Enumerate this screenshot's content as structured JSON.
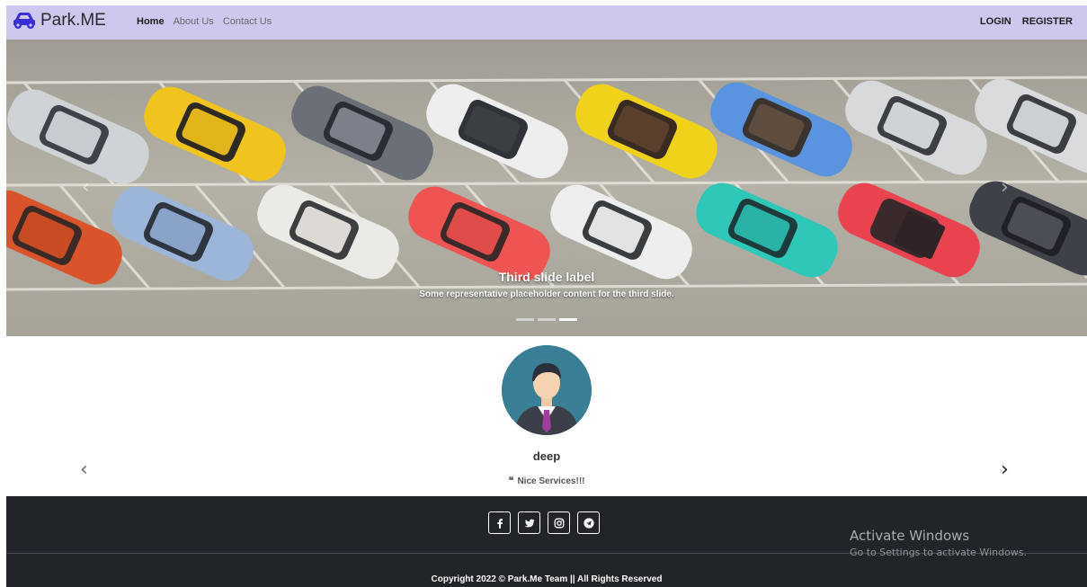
{
  "navbar": {
    "brand": "Park.ME",
    "links": [
      {
        "label": "Home",
        "active": true
      },
      {
        "label": "About Us",
        "active": false
      },
      {
        "label": "Contact Us",
        "active": false
      }
    ],
    "login": "LOGIN",
    "register": "REGISTER",
    "background": "#cfc8ee",
    "brand_icon": "car-icon",
    "brand_icon_color": "#3a2fd6"
  },
  "hero": {
    "caption_title": "Third slide label",
    "caption_text": "Some representative placeholder content for the third slide.",
    "slide_count": 3,
    "active_slide": 3,
    "prev_icon": "chevron-left-icon",
    "next_icon": "chevron-right-icon"
  },
  "testimonial": {
    "name": "deep",
    "quote_mark": "❝",
    "quote": "Nice Services!!!",
    "avatar_icon": "user-avatar-icon"
  },
  "footer": {
    "socials": [
      "facebook-icon",
      "twitter-icon",
      "instagram-icon",
      "telegram-icon"
    ],
    "copyright": "Copyright 2022 © Park.Me Team || All Rights Reserved",
    "background": "#212529"
  },
  "watermark": {
    "title": "Activate Windows",
    "subtitle": "Go to Settings to activate Windows."
  }
}
